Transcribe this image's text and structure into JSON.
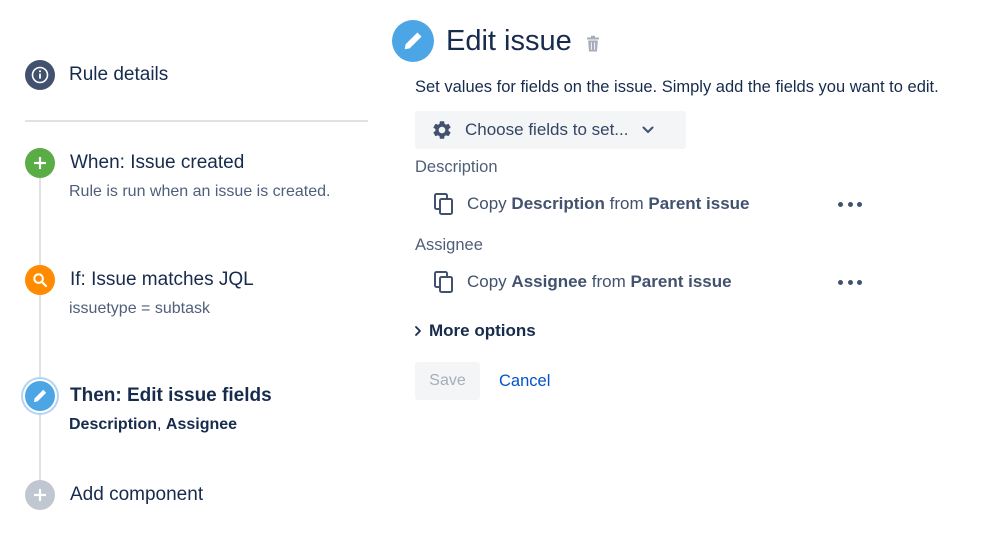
{
  "sidebar": {
    "rule_details": {
      "label": "Rule details",
      "icon": "info-icon"
    },
    "steps": [
      {
        "title": "When: Issue created",
        "subtitle": "Rule is run when an issue is created.",
        "icon": "plus-icon",
        "color": "#5aac44"
      },
      {
        "title": "If: Issue matches JQL",
        "subtitle": "issuetype = subtask",
        "icon": "search-icon",
        "color": "#ff8b00"
      },
      {
        "title": "Then: Edit issue fields",
        "subtitle_parts": [
          "Description",
          ", ",
          "Assignee"
        ],
        "icon": "pencil-icon",
        "color": "#4ca5e4"
      },
      {
        "title": "Add component",
        "icon": "plus-icon",
        "color": "#c1c7d0"
      }
    ]
  },
  "panel": {
    "title": "Edit issue",
    "icons": {
      "header": "pencil-icon",
      "delete": "trash-icon"
    },
    "intro": "Set values for fields on the issue. Simply add the fields you want to edit.",
    "chooser": {
      "label": "Choose fields to set...",
      "icon": "gear-icon",
      "caret": "chevron-down-icon"
    },
    "fields": [
      {
        "label": "Description",
        "copy": {
          "prefix": "Copy ",
          "field": "Description",
          "middle": " from ",
          "source": "Parent issue"
        }
      },
      {
        "label": "Assignee",
        "copy": {
          "prefix": "Copy ",
          "field": "Assignee",
          "middle": " from ",
          "source": "Parent issue"
        }
      }
    ],
    "more_options": "More options",
    "save_label": "Save",
    "cancel_label": "Cancel"
  },
  "colors": {
    "text_primary": "#172b4d",
    "text_secondary": "#505f79",
    "link": "#0052cc",
    "disabled": "#a5adba"
  }
}
